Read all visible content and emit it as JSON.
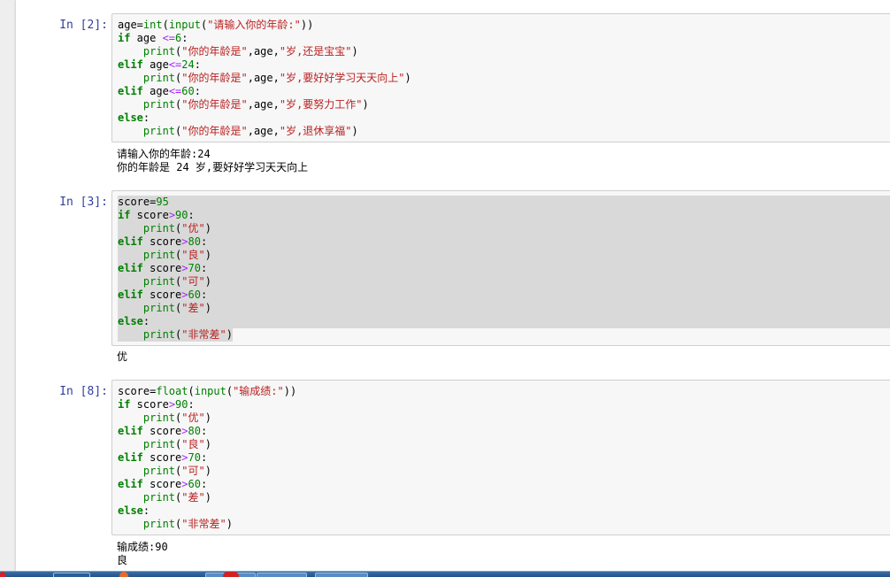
{
  "cells": [
    {
      "prompt": "In  [2]:",
      "code": [
        [
          [
            "n",
            "age="
          ],
          [
            "bi",
            "int"
          ],
          [
            "n",
            "("
          ],
          [
            "bi",
            "input"
          ],
          [
            "n",
            "("
          ],
          [
            "str",
            "\"请输入你的年龄:\""
          ],
          [
            "n",
            "))"
          ]
        ],
        [
          [
            "kw",
            "if"
          ],
          [
            "n",
            " age "
          ],
          [
            "op",
            "<="
          ],
          [
            "num",
            "6"
          ],
          [
            "n",
            ":"
          ]
        ],
        [
          [
            "n",
            "    "
          ],
          [
            "bi",
            "print"
          ],
          [
            "n",
            "("
          ],
          [
            "str",
            "\"你的年龄是\""
          ],
          [
            "n",
            ",age,"
          ],
          [
            "str",
            "\"岁,还是宝宝\""
          ],
          [
            "n",
            ")"
          ]
        ],
        [
          [
            "kw",
            "elif"
          ],
          [
            "n",
            " age"
          ],
          [
            "op",
            "<="
          ],
          [
            "num",
            "24"
          ],
          [
            "n",
            ":"
          ]
        ],
        [
          [
            "n",
            "    "
          ],
          [
            "bi",
            "print"
          ],
          [
            "n",
            "("
          ],
          [
            "str",
            "\"你的年龄是\""
          ],
          [
            "n",
            ",age,"
          ],
          [
            "str",
            "\"岁,要好好学习天天向上\""
          ],
          [
            "n",
            ")"
          ]
        ],
        [
          [
            "kw",
            "elif"
          ],
          [
            "n",
            " age"
          ],
          [
            "op",
            "<="
          ],
          [
            "num",
            "60"
          ],
          [
            "n",
            ":"
          ]
        ],
        [
          [
            "n",
            "    "
          ],
          [
            "bi",
            "print"
          ],
          [
            "n",
            "("
          ],
          [
            "str",
            "\"你的年龄是\""
          ],
          [
            "n",
            ",age,"
          ],
          [
            "str",
            "\"岁,要努力工作\""
          ],
          [
            "n",
            ")"
          ]
        ],
        [
          [
            "kw",
            "else"
          ],
          [
            "n",
            ":"
          ]
        ],
        [
          [
            "n",
            "    "
          ],
          [
            "bi",
            "print"
          ],
          [
            "n",
            "("
          ],
          [
            "str",
            "\"你的年龄是\""
          ],
          [
            "n",
            ",age,"
          ],
          [
            "str",
            "\"岁,退休享福\""
          ],
          [
            "n",
            ")"
          ]
        ]
      ],
      "output": [
        "请输入你的年龄:24",
        "你的年龄是 24 岁,要好好学习天天向上"
      ]
    },
    {
      "prompt": "In  [3]:",
      "code": [
        [
          [
            "n",
            "score="
          ],
          [
            "num",
            "95"
          ]
        ],
        [
          [
            "kw",
            "if"
          ],
          [
            "n",
            " score"
          ],
          [
            "op",
            ">"
          ],
          [
            "num",
            "90"
          ],
          [
            "n",
            ":"
          ]
        ],
        [
          [
            "n",
            "    "
          ],
          [
            "bi",
            "print"
          ],
          [
            "n",
            "("
          ],
          [
            "str",
            "\"优\""
          ],
          [
            "n",
            ")"
          ]
        ],
        [
          [
            "kw",
            "elif"
          ],
          [
            "n",
            " score"
          ],
          [
            "op",
            ">"
          ],
          [
            "num",
            "80"
          ],
          [
            "n",
            ":"
          ]
        ],
        [
          [
            "n",
            "    "
          ],
          [
            "bi",
            "print"
          ],
          [
            "n",
            "("
          ],
          [
            "str",
            "\"良\""
          ],
          [
            "n",
            ")"
          ]
        ],
        [
          [
            "kw",
            "elif"
          ],
          [
            "n",
            " score"
          ],
          [
            "op",
            ">"
          ],
          [
            "num",
            "70"
          ],
          [
            "n",
            ":"
          ]
        ],
        [
          [
            "n",
            "    "
          ],
          [
            "bi",
            "print"
          ],
          [
            "n",
            "("
          ],
          [
            "str",
            "\"可\""
          ],
          [
            "n",
            ")"
          ]
        ],
        [
          [
            "kw",
            "elif"
          ],
          [
            "n",
            " score"
          ],
          [
            "op",
            ">"
          ],
          [
            "num",
            "60"
          ],
          [
            "n",
            ":"
          ]
        ],
        [
          [
            "n",
            "    "
          ],
          [
            "bi",
            "print"
          ],
          [
            "n",
            "("
          ],
          [
            "str",
            "\"差\""
          ],
          [
            "n",
            ")"
          ]
        ],
        [
          [
            "kw",
            "else"
          ],
          [
            "n",
            ":"
          ]
        ],
        [
          [
            "n",
            "    "
          ],
          [
            "bi",
            "print"
          ],
          [
            "n",
            "("
          ],
          [
            "str",
            "\"非常差\""
          ],
          [
            "n",
            ")"
          ]
        ]
      ],
      "output": [
        "优"
      ]
    },
    {
      "prompt": "In  [8]:",
      "code": [
        [
          [
            "n",
            "score="
          ],
          [
            "bi",
            "float"
          ],
          [
            "n",
            "("
          ],
          [
            "bi",
            "input"
          ],
          [
            "n",
            "("
          ],
          [
            "str",
            "\"输成绩:\""
          ],
          [
            "n",
            "))"
          ]
        ],
        [
          [
            "kw",
            "if"
          ],
          [
            "n",
            " score"
          ],
          [
            "op",
            ">"
          ],
          [
            "num",
            "90"
          ],
          [
            "n",
            ":"
          ]
        ],
        [
          [
            "n",
            "    "
          ],
          [
            "bi",
            "print"
          ],
          [
            "n",
            "("
          ],
          [
            "str",
            "\"优\""
          ],
          [
            "n",
            ")"
          ]
        ],
        [
          [
            "kw",
            "elif"
          ],
          [
            "n",
            " score"
          ],
          [
            "op",
            ">"
          ],
          [
            "num",
            "80"
          ],
          [
            "n",
            ":"
          ]
        ],
        [
          [
            "n",
            "    "
          ],
          [
            "bi",
            "print"
          ],
          [
            "n",
            "("
          ],
          [
            "str",
            "\"良\""
          ],
          [
            "n",
            ")"
          ]
        ],
        [
          [
            "kw",
            "elif"
          ],
          [
            "n",
            " score"
          ],
          [
            "op",
            ">"
          ],
          [
            "num",
            "70"
          ],
          [
            "n",
            ":"
          ]
        ],
        [
          [
            "n",
            "    "
          ],
          [
            "bi",
            "print"
          ],
          [
            "n",
            "("
          ],
          [
            "str",
            "\"可\""
          ],
          [
            "n",
            ")"
          ]
        ],
        [
          [
            "kw",
            "elif"
          ],
          [
            "n",
            " score"
          ],
          [
            "op",
            ">"
          ],
          [
            "num",
            "60"
          ],
          [
            "n",
            ":"
          ]
        ],
        [
          [
            "n",
            "    "
          ],
          [
            "bi",
            "print"
          ],
          [
            "n",
            "("
          ],
          [
            "str",
            "\"差\""
          ],
          [
            "n",
            ")"
          ]
        ],
        [
          [
            "kw",
            "else"
          ],
          [
            "n",
            ":"
          ]
        ],
        [
          [
            "n",
            "    "
          ],
          [
            "bi",
            "print"
          ],
          [
            "n",
            "("
          ],
          [
            "str",
            "\"非常差\""
          ],
          [
            "n",
            ")"
          ]
        ]
      ],
      "output": [
        "输成绩:90",
        "良"
      ]
    }
  ],
  "colors": {
    "prompt": "#303f9f",
    "keyword": "#008000",
    "operator": "#aa22ff",
    "string": "#ba2121",
    "selection": "#d9d9d9"
  }
}
